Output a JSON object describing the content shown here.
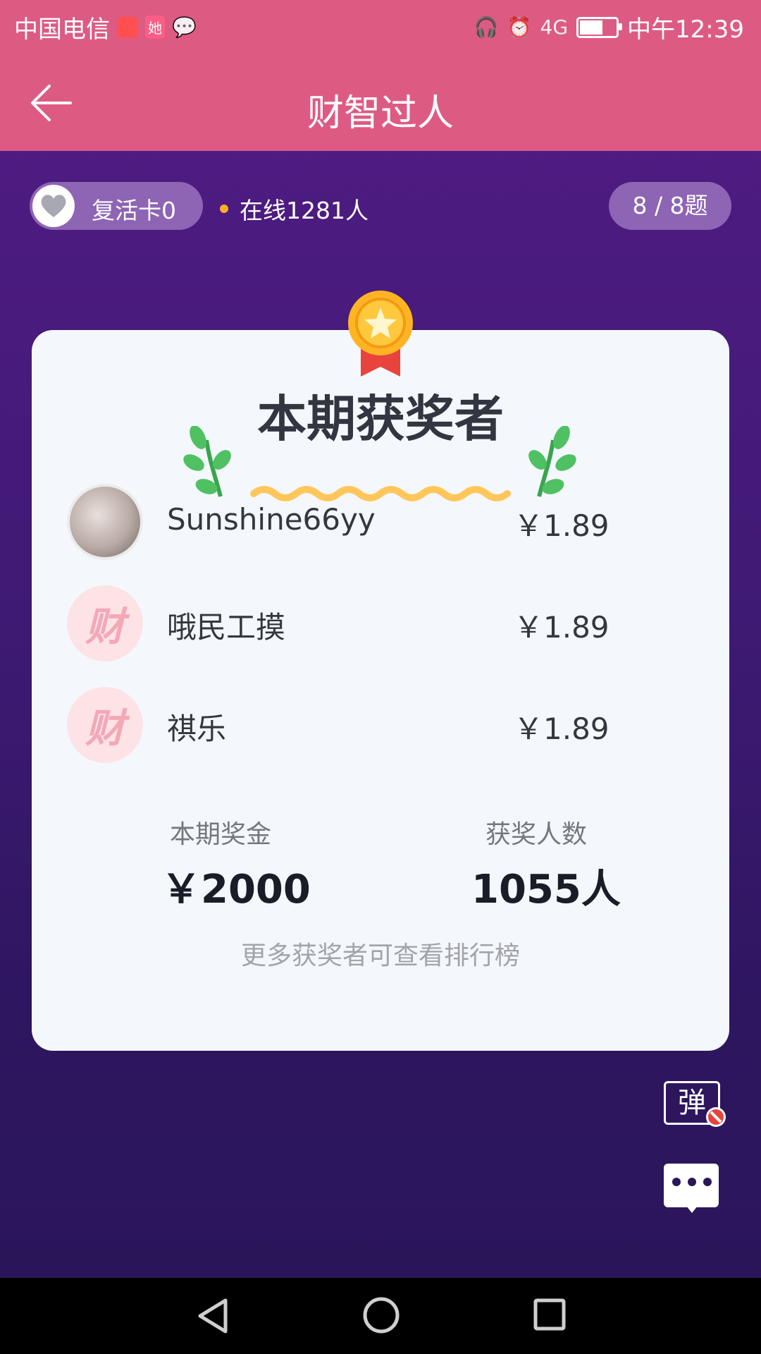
{
  "status_bar": {
    "carrier": "中国电信",
    "app2_label": "她",
    "time": "中午12:39",
    "network": "4G"
  },
  "header": {
    "title": "财智过人"
  },
  "top_bar": {
    "revive_card": "复活卡0",
    "online": "在线1281人",
    "question_progress": "8 / 8题"
  },
  "card": {
    "title": "本期获奖者",
    "winners": [
      {
        "name": "Sunshine66yy",
        "amount": "￥1.89",
        "avatar": "photo"
      },
      {
        "name": "哦民工摸",
        "amount": "￥1.89",
        "avatar": "财"
      },
      {
        "name": "祺乐",
        "amount": "￥1.89",
        "avatar": "财"
      }
    ],
    "prize_label": "本期奖金",
    "prize_value": "￥2000",
    "winners_count_label": "获奖人数",
    "winners_count_value": "1055人",
    "note": "更多获奖者可查看排行榜"
  },
  "controls": {
    "danmu_label": "弹"
  },
  "colors": {
    "header_pink": "#dd5b83",
    "bg_purple": "#531c86",
    "card_bg": "#f4f8fc",
    "accent_gold": "#ffad2a"
  }
}
